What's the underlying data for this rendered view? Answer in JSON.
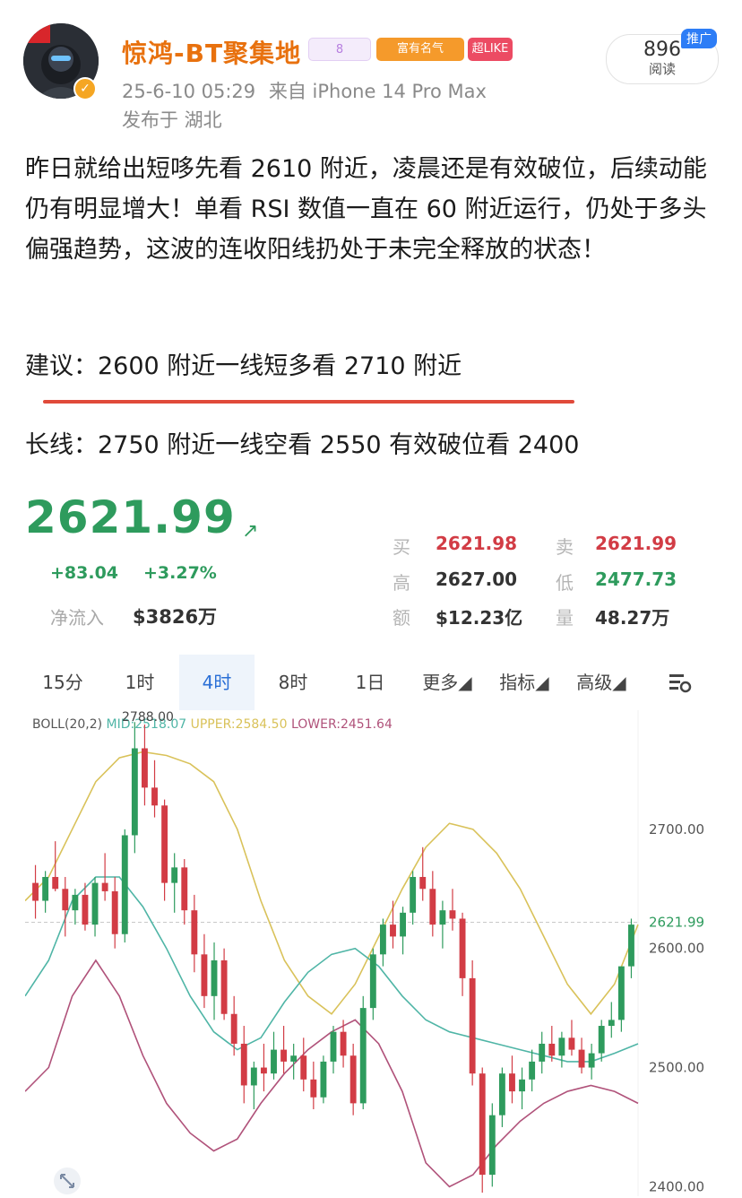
{
  "post": {
    "username": "惊鸿-BT聚集地",
    "badges": {
      "level": "8",
      "rich": "富有名气",
      "superlike": "超LIKE"
    },
    "timestamp": "25-6-10 05:29",
    "source": "来自 iPhone 14 Pro Max",
    "location": "发布于 湖北",
    "read_count": "896",
    "read_label": "阅读",
    "promo_tag": "推广",
    "body": "昨日就给出短哆先看 2610 附近，凌晨还是有效破位，后续动能仍有明显增大！单看 RSI 数值一直在 60 附近运行，仍处于多头偏强趋势，这波的连收阳线扔处于未完全释放的状态！",
    "suggest": "建议：2600 附近一线短多看 2710 附近",
    "long": "长线：2750 附近一线空看 2550 有效破位看 2400"
  },
  "quote": {
    "price": "2621.99",
    "change_abs": "+83.04",
    "change_pct": "+3.27%",
    "netflow_label": "净流入",
    "netflow_value": "$3826万",
    "buy_label": "买",
    "buy_value": "2621.98",
    "sell_label": "卖",
    "sell_value": "2621.99",
    "high_label": "高",
    "high_value": "2627.00",
    "low_label": "低",
    "low_value": "2477.73",
    "amount_label": "额",
    "amount_value": "$12.23亿",
    "volume_label": "量",
    "volume_value": "48.27万"
  },
  "tabs": [
    "15分",
    "1时",
    "4时",
    "8时",
    "1日",
    "更多◢",
    "指标◢",
    "高级◢"
  ],
  "colors": {
    "up": "#2e9b5d",
    "down": "#d23c45",
    "accent": "#e8710e",
    "boll_mid": "#4fb5a6",
    "boll_upper": "#d9c25a",
    "boll_lower": "#b0527a"
  },
  "chart_data": {
    "type": "candlestick",
    "indicator": {
      "name": "BOLL(20,2)",
      "mid_label": "MID:2518.07",
      "upper_label": "UPPER:2584.50",
      "lower_label": "LOWER:2451.64"
    },
    "y_ticks": [
      "2700.00",
      "2600.00",
      "2500.00",
      "2400.00"
    ],
    "y_tick_values": [
      2700,
      2600,
      2500,
      2400
    ],
    "last_price_label": "2621.99",
    "last_price": 2621.99,
    "max_label": "2788.00",
    "max_value": 2788,
    "ylim": [
      2392,
      2800
    ],
    "candles": [
      [
        2655,
        2670,
        2625,
        2640
      ],
      [
        2640,
        2665,
        2630,
        2660
      ],
      [
        2660,
        2690,
        2648,
        2650
      ],
      [
        2650,
        2660,
        2610,
        2632
      ],
      [
        2632,
        2650,
        2620,
        2645
      ],
      [
        2645,
        2655,
        2615,
        2620
      ],
      [
        2620,
        2660,
        2610,
        2655
      ],
      [
        2655,
        2680,
        2640,
        2648
      ],
      [
        2648,
        2660,
        2600,
        2612
      ],
      [
        2612,
        2700,
        2605,
        2695
      ],
      [
        2695,
        2790,
        2680,
        2768
      ],
      [
        2768,
        2788,
        2720,
        2735
      ],
      [
        2735,
        2758,
        2710,
        2720
      ],
      [
        2720,
        2725,
        2640,
        2655
      ],
      [
        2655,
        2680,
        2630,
        2668
      ],
      [
        2668,
        2675,
        2620,
        2632
      ],
      [
        2632,
        2645,
        2580,
        2595
      ],
      [
        2595,
        2612,
        2550,
        2560
      ],
      [
        2560,
        2605,
        2540,
        2590
      ],
      [
        2590,
        2600,
        2540,
        2545
      ],
      [
        2545,
        2560,
        2510,
        2520
      ],
      [
        2520,
        2535,
        2470,
        2485
      ],
      [
        2485,
        2505,
        2465,
        2500
      ],
      [
        2500,
        2520,
        2480,
        2495
      ],
      [
        2495,
        2530,
        2490,
        2515
      ],
      [
        2515,
        2535,
        2495,
        2505
      ],
      [
        2505,
        2520,
        2490,
        2510
      ],
      [
        2510,
        2525,
        2480,
        2490
      ],
      [
        2490,
        2505,
        2465,
        2475
      ],
      [
        2475,
        2510,
        2470,
        2505
      ],
      [
        2505,
        2535,
        2495,
        2530
      ],
      [
        2530,
        2540,
        2500,
        2510
      ],
      [
        2510,
        2520,
        2460,
        2470
      ],
      [
        2470,
        2560,
        2465,
        2550
      ],
      [
        2550,
        2600,
        2540,
        2595
      ],
      [
        2595,
        2625,
        2585,
        2620
      ],
      [
        2620,
        2640,
        2600,
        2610
      ],
      [
        2610,
        2635,
        2595,
        2630
      ],
      [
        2630,
        2665,
        2620,
        2660
      ],
      [
        2660,
        2685,
        2640,
        2650
      ],
      [
        2650,
        2665,
        2610,
        2620
      ],
      [
        2620,
        2640,
        2600,
        2632
      ],
      [
        2632,
        2650,
        2615,
        2625
      ],
      [
        2625,
        2630,
        2560,
        2575
      ],
      [
        2575,
        2590,
        2485,
        2495
      ],
      [
        2495,
        2500,
        2395,
        2410
      ],
      [
        2410,
        2470,
        2400,
        2460
      ],
      [
        2460,
        2500,
        2450,
        2495
      ],
      [
        2495,
        2510,
        2470,
        2480
      ],
      [
        2480,
        2500,
        2465,
        2490
      ],
      [
        2490,
        2515,
        2480,
        2505
      ],
      [
        2505,
        2530,
        2495,
        2520
      ],
      [
        2520,
        2535,
        2505,
        2510
      ],
      [
        2510,
        2530,
        2500,
        2525
      ],
      [
        2525,
        2540,
        2510,
        2515
      ],
      [
        2515,
        2525,
        2495,
        2500
      ],
      [
        2500,
        2520,
        2490,
        2512
      ],
      [
        2512,
        2540,
        2505,
        2535
      ],
      [
        2535,
        2555,
        2525,
        2540
      ],
      [
        2540,
        2560,
        2530,
        2585
      ],
      [
        2585,
        2625,
        2575,
        2620
      ]
    ],
    "boll_upper": [
      2640,
      2660,
      2700,
      2740,
      2760,
      2765,
      2762,
      2755,
      2740,
      2700,
      2640,
      2590,
      2560,
      2545,
      2570,
      2610,
      2650,
      2685,
      2705,
      2700,
      2680,
      2650,
      2610,
      2570,
      2545,
      2570,
      2620
    ],
    "boll_mid": [
      2560,
      2590,
      2640,
      2660,
      2660,
      2635,
      2600,
      2560,
      2530,
      2515,
      2525,
      2555,
      2580,
      2595,
      2600,
      2585,
      2560,
      2540,
      2530,
      2525,
      2520,
      2515,
      2510,
      2505,
      2505,
      2512,
      2520
    ],
    "boll_lower": [
      2480,
      2500,
      2560,
      2590,
      2560,
      2510,
      2470,
      2445,
      2430,
      2440,
      2470,
      2495,
      2515,
      2530,
      2540,
      2520,
      2480,
      2420,
      2400,
      2410,
      2435,
      2455,
      2470,
      2480,
      2485,
      2480,
      2470
    ]
  }
}
